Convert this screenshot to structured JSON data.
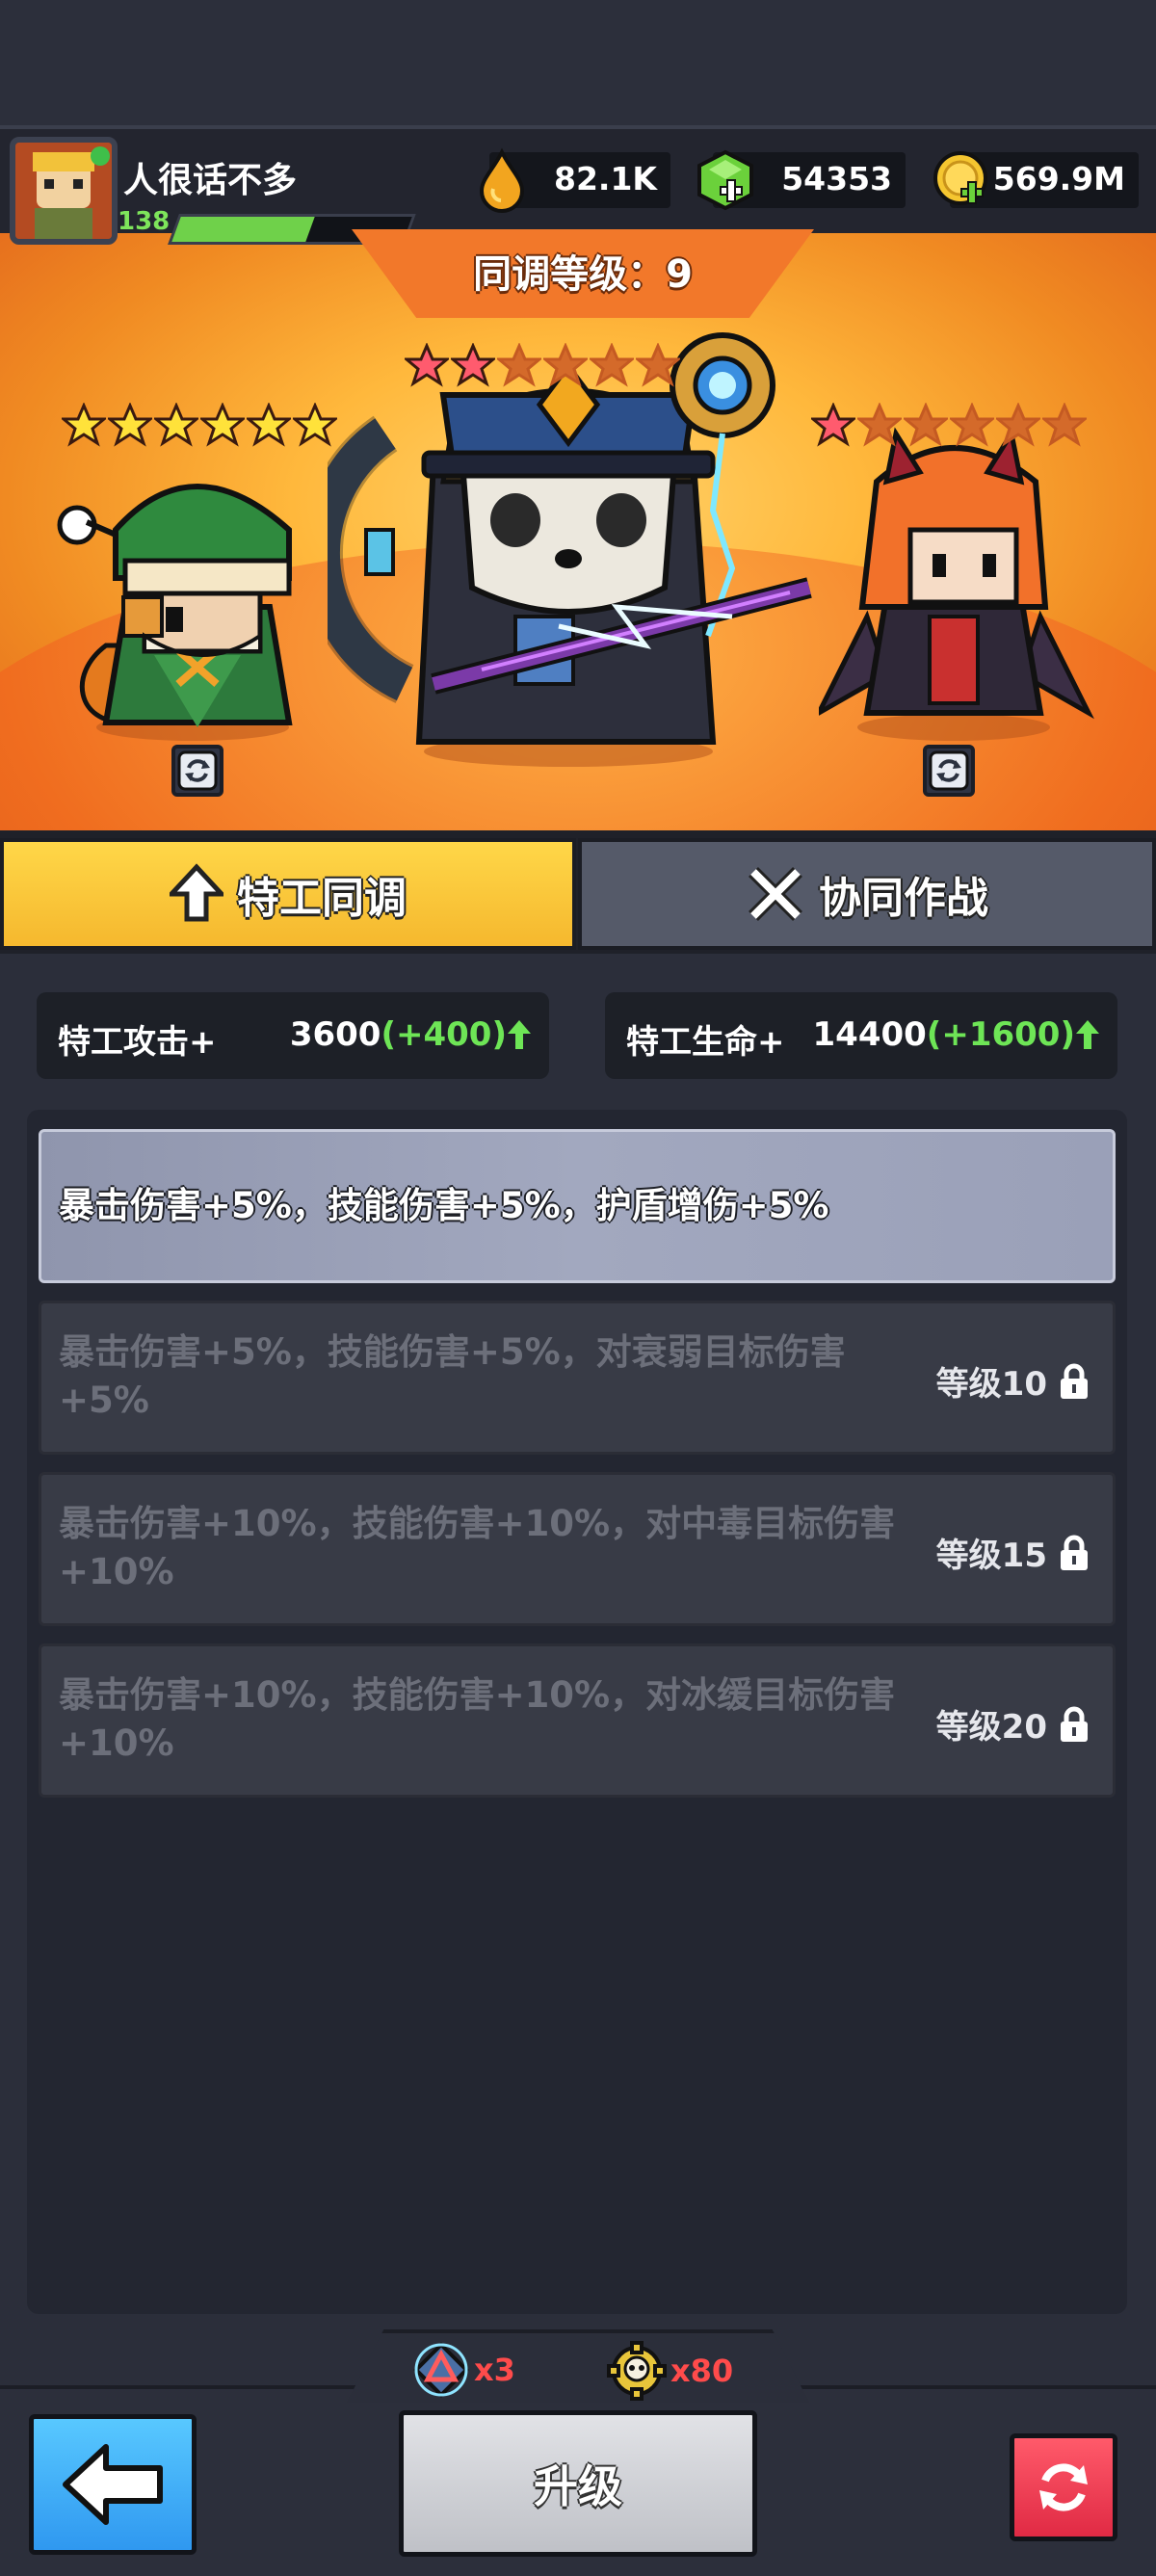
{
  "player": {
    "name": "人很话不多",
    "level": "138",
    "xp_fraction": 0.58
  },
  "currencies": [
    {
      "icon": "drop-icon",
      "value": "82.1K"
    },
    {
      "icon": "gem-icon",
      "value": "54353"
    },
    {
      "icon": "coin-icon",
      "value": "569.9M"
    }
  ],
  "sync": {
    "label": "同调等级：9"
  },
  "characters": {
    "left": {
      "name": "elf",
      "stars_filled": 6,
      "stars_total": 6
    },
    "center": {
      "name": "panda-officer",
      "stars_filled": 2,
      "stars_total": 6
    },
    "right": {
      "name": "demon-girl",
      "stars_filled": 1,
      "stars_total": 6
    }
  },
  "tabs": {
    "active": "特工同调",
    "inactive": "协同作战"
  },
  "stats": {
    "attack": {
      "name": "特工攻击+",
      "value": "3600",
      "bonus": "(+400)"
    },
    "hp": {
      "name": "特工生命+",
      "value": "14400",
      "bonus": "(+1600)"
    }
  },
  "bonuses": [
    {
      "text": "暴击伤害+5%，技能伤害+5%，护盾增伤+5%",
      "lock": ""
    },
    {
      "text": "暴击伤害+5%，技能伤害+5%，对衰弱目标伤害+5%",
      "lock": "等级10"
    },
    {
      "text": "暴击伤害+10%，技能伤害+10%，对中毒目标伤害+10%",
      "lock": "等级15"
    },
    {
      "text": "暴击伤害+10%，技能伤害+10%，对冰缓目标伤害+10%",
      "lock": "等级20"
    }
  ],
  "cost": {
    "item1": "x3",
    "item2": "x80"
  },
  "buttons": {
    "upgrade": "升级"
  },
  "colors": {
    "active_tab": "#f5b82e",
    "bonus_green": "#6ee556",
    "cost_red": "#ff4b4b"
  }
}
